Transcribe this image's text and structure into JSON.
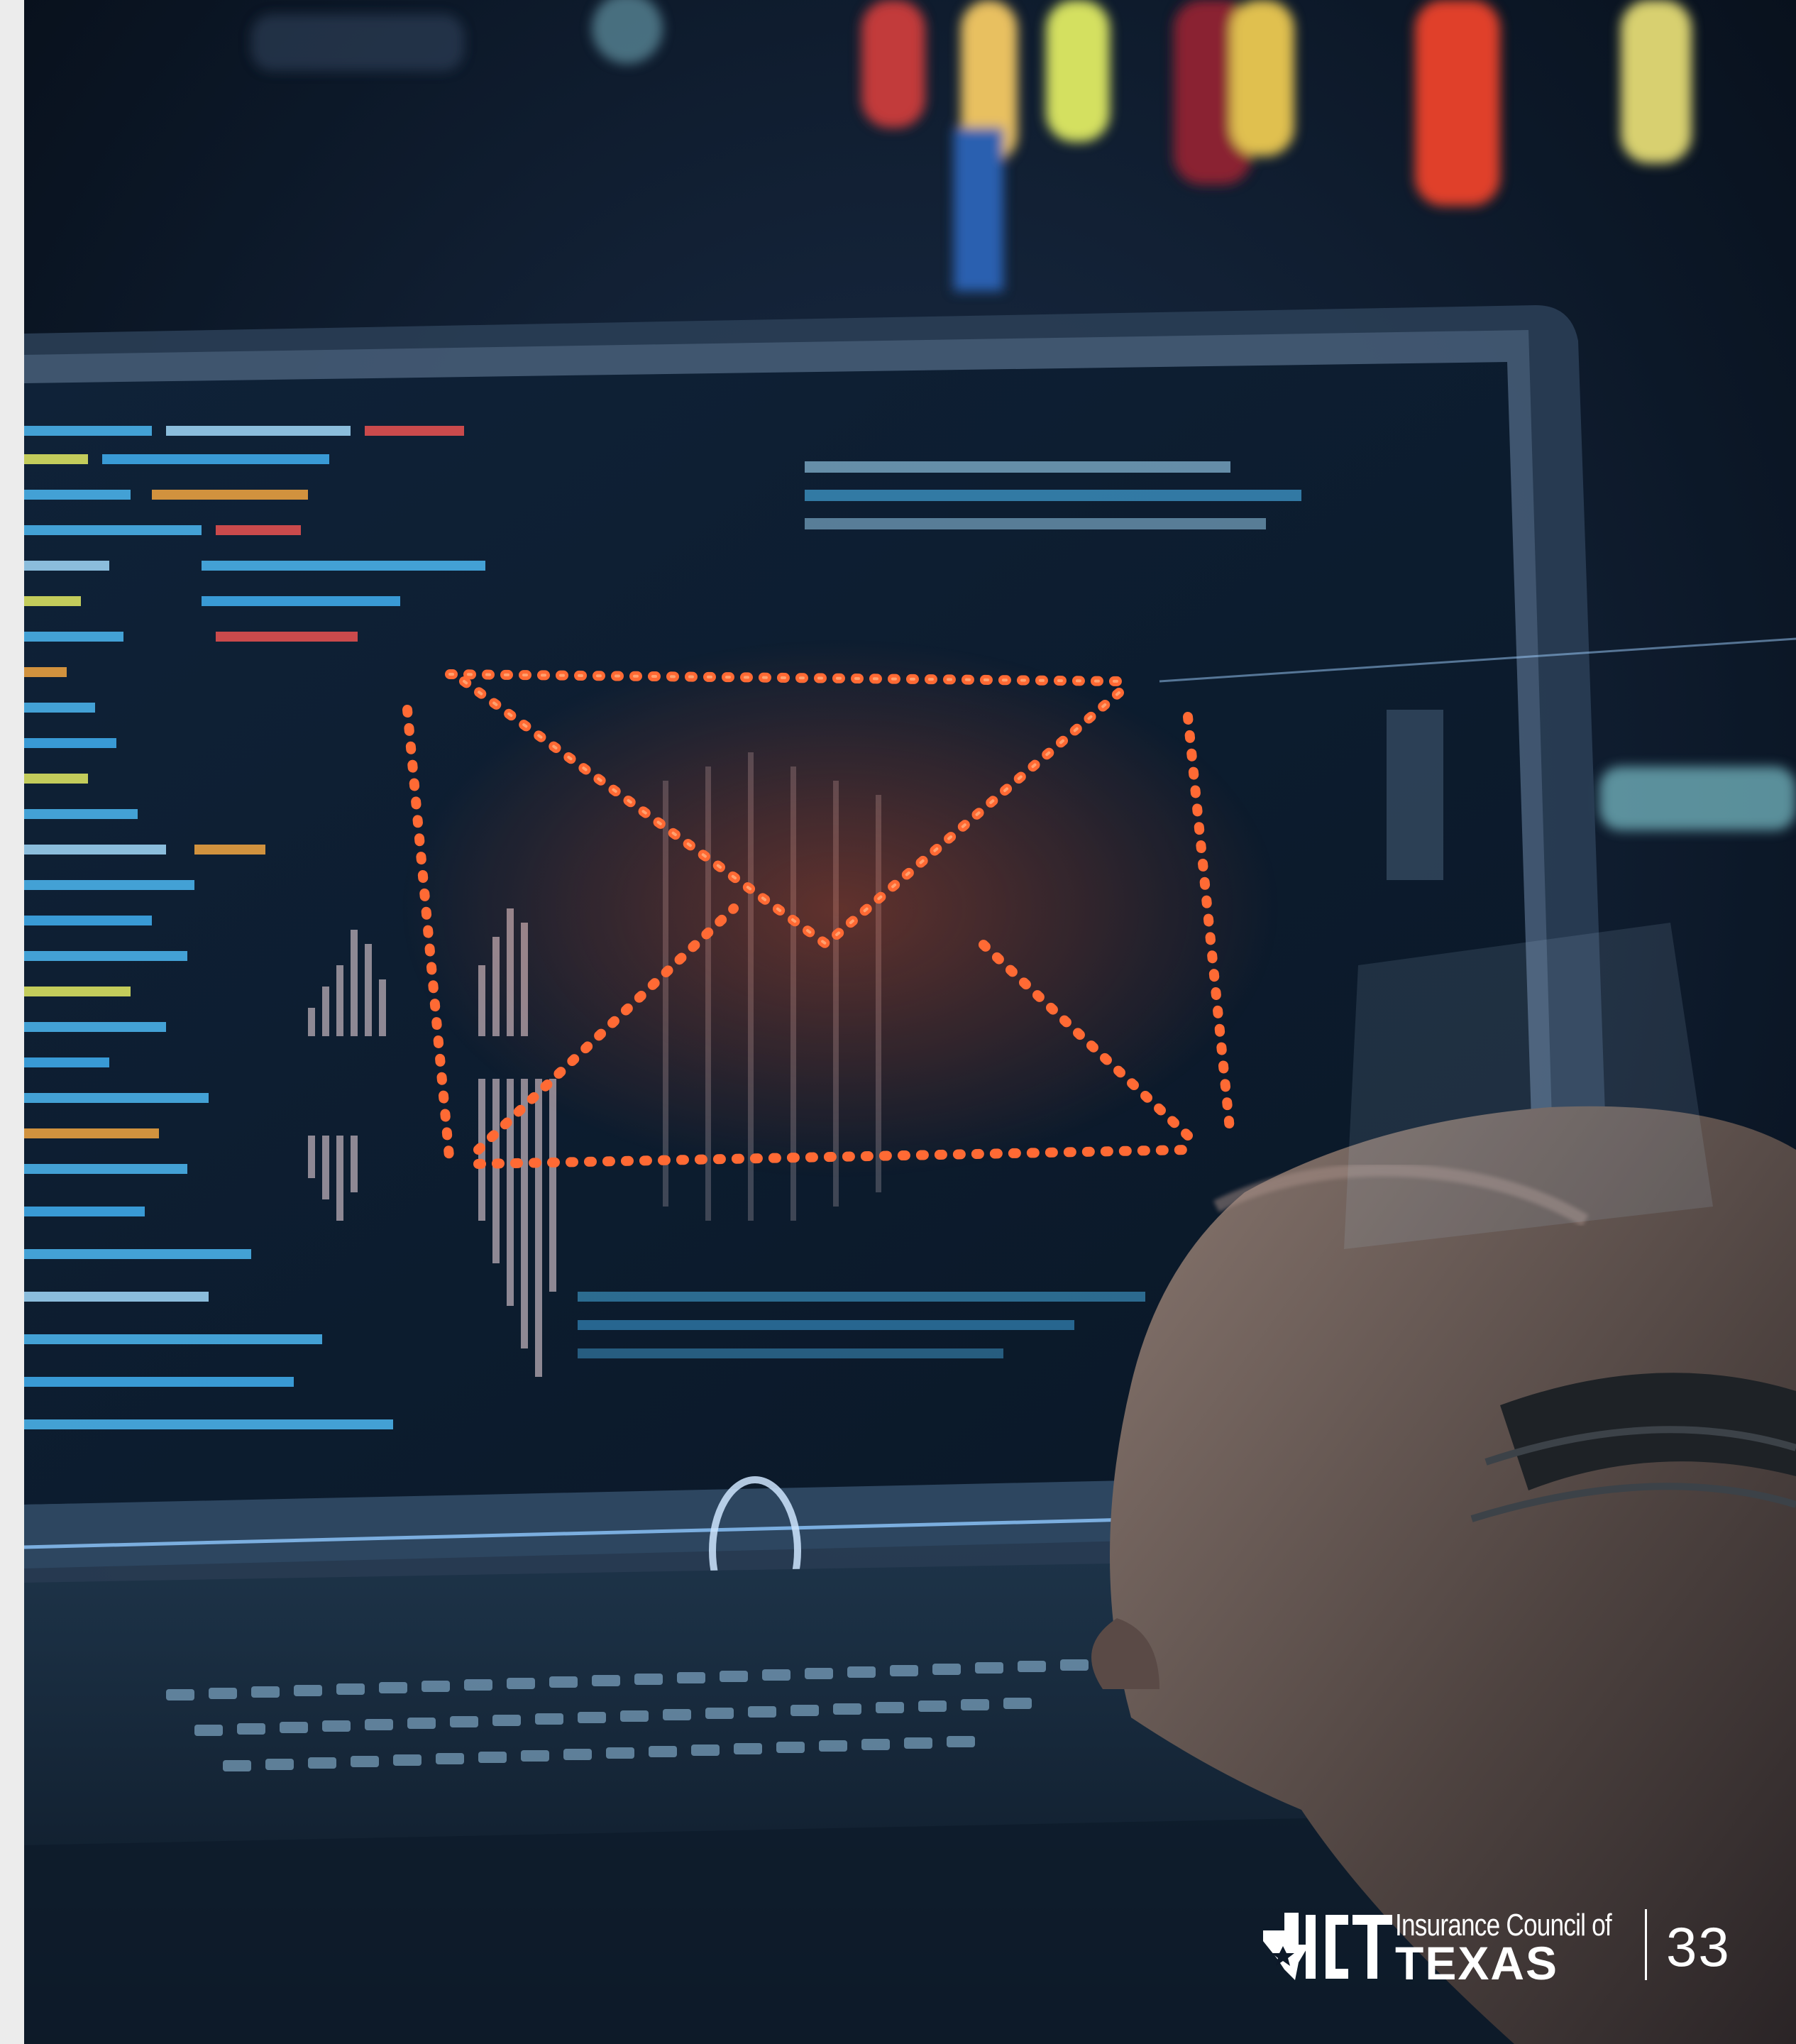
{
  "image": {
    "description_name": "hacker-laptop-email-phishing-photo",
    "accent_colors": {
      "email_glow": "#ff5a2a",
      "screen_code": "#3fa9e8",
      "background": "#0a1a2e"
    }
  },
  "branding": {
    "logo_text_small": "Insurance Council of",
    "logo_text_large": "TEXAS",
    "logo_mark_icon": "ict-logo-mark-icon",
    "page_number": "33"
  }
}
